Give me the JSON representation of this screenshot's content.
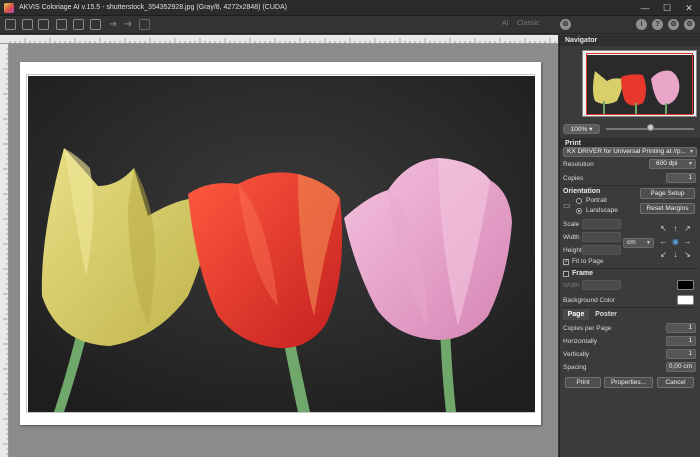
{
  "window": {
    "title": "AKVIS Coloriage AI v.15.5 - shutterstock_354352928.jpg (Gray/8, 4272x2848) (CUDA)",
    "controls": [
      "minimize-icon",
      "maximize-icon",
      "close-icon"
    ]
  },
  "toolbar": {
    "ai_label": "AI",
    "classic_label": "Classic"
  },
  "navigator": {
    "title": "Navigator",
    "zoom": "100%"
  },
  "print": {
    "section_title": "Print",
    "printer": "KX DRIVER for Universal Printing at //p...",
    "resolution_label": "Resolution",
    "resolution_value": "600 dpi",
    "copies_label": "Copies",
    "copies_value": "1",
    "orientation_label": "Orientation",
    "portrait_label": "Portrait",
    "landscape_label": "Landscape",
    "orientation_selected": "Landscape",
    "page_setup_label": "Page Setup",
    "reset_margins_label": "Reset Margins",
    "scale_label": "Scale",
    "width_label": "Width",
    "height_label": "Height",
    "unit_value": "cm",
    "fit_to_page_label": "Fit to Page",
    "fit_to_page_checked": true,
    "frame_label": "Frame",
    "frame_checked": false,
    "frame_width_label": "Width",
    "frame_color": "#000000",
    "background_color_label": "Background Color",
    "background_color": "#ffffff"
  },
  "page_tabs": {
    "tabs": [
      "Page",
      "Poster"
    ],
    "active": "Page",
    "copies_per_page_label": "Copies per Page",
    "copies_per_page_value": "1",
    "horizontally_label": "Horizontally",
    "horizontally_value": "1",
    "vertically_label": "Vertically",
    "vertically_value": "1",
    "spacing_label": "Spacing",
    "spacing_value": "0,00 cm"
  },
  "actions": {
    "print_label": "Print",
    "properties_label": "Properties...",
    "cancel_label": "Cancel"
  },
  "colors": {
    "tulip_yellow": "#d9cf6a",
    "tulip_red": "#e8382c",
    "tulip_pink": "#e9a6c9",
    "stem_green": "#6fa86a",
    "background_dark": "#2c2c2c"
  }
}
